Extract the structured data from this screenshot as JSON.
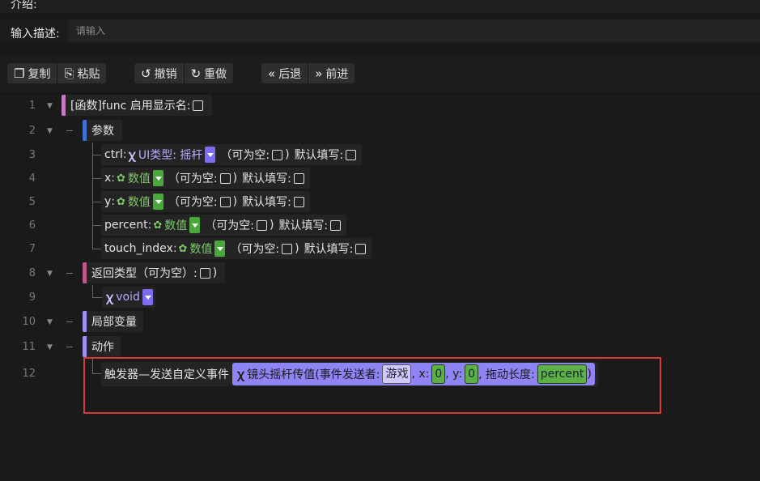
{
  "header": {
    "intro_label": "介绍:",
    "desc_label": "输入描述:",
    "desc_placeholder": "请输入"
  },
  "toolbar": {
    "copy": "复制",
    "paste": "粘贴",
    "undo": "撤销",
    "redo": "重做",
    "back": "后退",
    "forward": "前进"
  },
  "editor": {
    "line_numbers": [
      "1",
      "2",
      "3",
      "4",
      "5",
      "6",
      "7",
      "8",
      "9",
      "10",
      "11",
      "12"
    ],
    "func_header": "[函数]func 启用显示名:",
    "params_label": "参数",
    "params": [
      {
        "name": "ctrl",
        "type": "UI类型: 摇杆",
        "nullable": "（可为空:",
        "default": "默认填写:"
      },
      {
        "name": "x",
        "type": "数值",
        "nullable": "（可为空:",
        "default": "默认填写:"
      },
      {
        "name": "y",
        "type": "数值",
        "nullable": "（可为空:",
        "default": "默认填写:"
      },
      {
        "name": "percent",
        "type": "数值",
        "nullable": "（可为空:",
        "default": "默认填写:"
      },
      {
        "name": "touch_index",
        "type": "数值",
        "nullable": "（可为空:",
        "default": "默认填写:"
      }
    ],
    "return_label": "返回类型（可为空）:",
    "return_type": "void",
    "locals_label": "局部变量",
    "actions_label": "动作",
    "action": {
      "prefix": "触发器—发送自定义事件",
      "call": "镜头摇杆传值(事件发送者:",
      "sender": "游戏",
      "x_label": ", x:",
      "x_val": "0",
      "y_label": ", y:",
      "y_val": "0",
      "len_label": ", 拖动长度:",
      "len_val": "percent",
      "close": ")"
    }
  },
  "colors": {
    "accent_selection": "#d63a3a",
    "func_bar": "#c47bc4",
    "params_bar": "#3f6fd0",
    "return_bar": "#c0568e",
    "locals_bar": "#9e90f5",
    "type_purple": "#7b6cf6",
    "type_green": "#4aa83a"
  }
}
